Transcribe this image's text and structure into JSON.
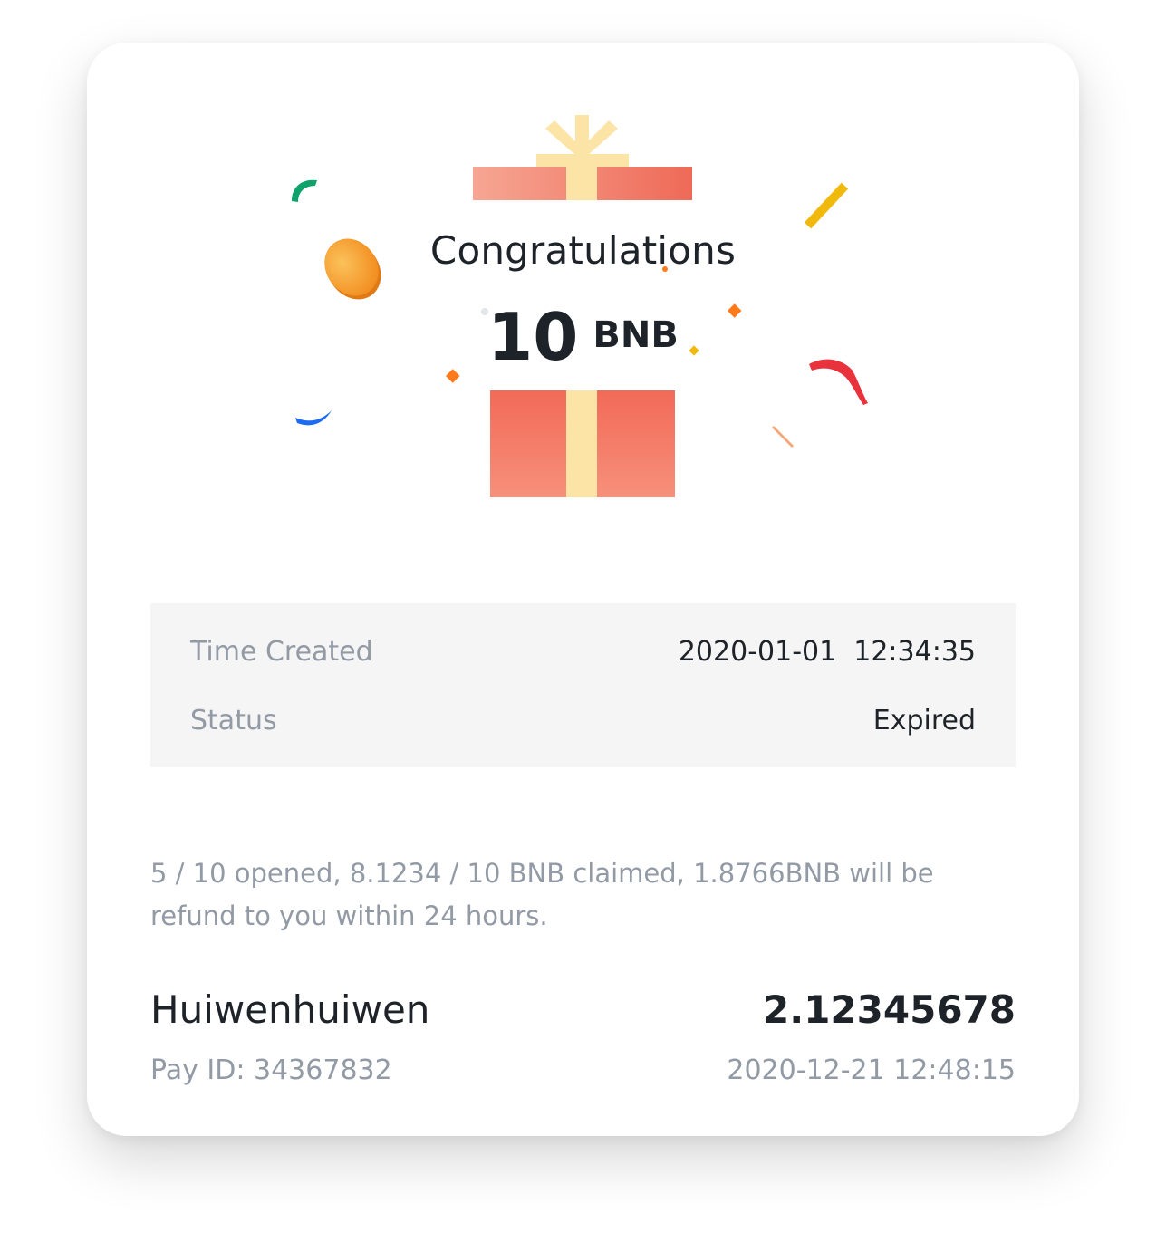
{
  "hero": {
    "title": "Congratulations",
    "amount": "10",
    "currency": "BNB",
    "illustration": "gift-box-confetti",
    "colors": {
      "gift_red": "#f0705e",
      "gift_ribbon": "#fce3a6",
      "coin": "#f5a623",
      "confetti_green": "#0ea36b",
      "confetti_blue": "#1c6bf2",
      "confetti_red": "#e8323c",
      "confetti_yellow": "#f0b90b",
      "confetti_orange": "#ff7a1a"
    }
  },
  "info": {
    "time_created_label": "Time Created",
    "time_created_value": "2020-01-01  12:34:35",
    "status_label": "Status",
    "status_value": "Expired"
  },
  "summary": {
    "text": "5 / 10 opened, 8.1234 / 10 BNB claimed, 1.8766BNB will be refund to you within 24 hours."
  },
  "claims": [
    {
      "user": "Huiwenhuiwen",
      "amount": "2.12345678",
      "pay_id": "Pay ID: 34367832",
      "time": "2020-12-21 12:48:15"
    }
  ]
}
